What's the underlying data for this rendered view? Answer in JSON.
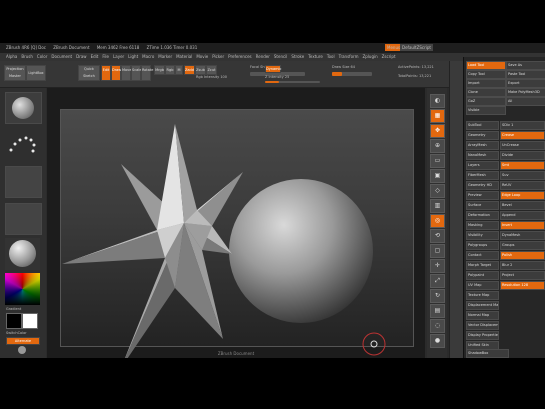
{
  "title_bar": {
    "items": [
      "ZBrush 4R6 [Q] Doc",
      "ZBrush Document",
      "Mem 3462 Free 6118",
      "ZTime 1.036 Timer 0.031"
    ],
    "right_buttons": [
      "Menus",
      "DefaultZScript"
    ]
  },
  "menu_bar": {
    "items": [
      "Alpha",
      "Brush",
      "Color",
      "Document",
      "Draw",
      "Edit",
      "File",
      "Layer",
      "Light",
      "Macro",
      "Marker",
      "Material",
      "Movie",
      "Picker",
      "Preferences",
      "Render",
      "Stencil",
      "Stroke",
      "Texture",
      "Tool",
      "Transform",
      "Zplugin",
      "Zscript"
    ]
  },
  "toolbar": {
    "projection_master": "Projection Master",
    "lightbox": "LightBox",
    "quick_sketch": "Quick Sketch",
    "edit": "Edit",
    "draw": "Draw",
    "move": "Move",
    "scale": "Scale",
    "rotate": "Rotate",
    "mrgb": "Mrgb",
    "rgb": "Rgb",
    "m": "M",
    "zadd": "Zadd",
    "zsub": "Zsub",
    "zcut": "Zcut",
    "focal_shift_label": "Focal Shift 0",
    "draw_size_label": "Draw Size 64",
    "dynamic": "Dynamic",
    "z_intensity_label": "Z Intensity 25",
    "rgb_intensity_label": "Rgb Intensity 100",
    "active_points": "ActivePoints: 13,221",
    "total_points": "TotalPoints: 13,221"
  },
  "left_shelf": {
    "brush_label": "Standard",
    "stroke_label": "Dots",
    "alpha_label": "Off",
    "texture_label": "Off",
    "material_label": "MatCap Gray",
    "gradient_label": "Gradient",
    "switch_color": "SwitchColor",
    "alternate": "Alternate"
  },
  "right_shelf": {
    "icons": [
      "BPR",
      "SPix 3",
      "Scroll",
      "Zoom",
      "Actual",
      "AAHalf",
      "Persp",
      "Floor",
      "Local",
      "LSym",
      "Frame",
      "Move",
      "Scale",
      "Rotate",
      "PolyF",
      "Transp",
      "Solo"
    ]
  },
  "tool_panel": {
    "header_buttons": [
      "Load Tool",
      "Save As",
      "Copy Tool",
      "Paste Tool",
      "Import",
      "Export",
      "Clone",
      "Make PolyMesh3D",
      "GoZ",
      "All",
      "Visible"
    ],
    "subtool_items": [
      "SubTool",
      "Geometry",
      "ArrayMesh",
      "NanoMesh",
      "Layers",
      "FiberMesh",
      "Geometry HD",
      "Preview",
      "Surface",
      "Deformation",
      "Masking",
      "Visibility",
      "Polygroups",
      "Contact",
      "Morph Target",
      "Polypaint",
      "UV Map",
      "Texture Map",
      "Displacement Map",
      "Normal Map",
      "Vector Displacement Map",
      "Display Properties",
      "Unified Skin",
      "Initialize",
      "Import",
      "Export"
    ],
    "slider_values": [
      "SDiv 1",
      "Crease",
      "UnCrease",
      "Divide",
      "Smt",
      "Suv",
      "ReUV",
      "Edge Loop",
      "Bevel",
      "Append",
      "Insert",
      "DynaMesh",
      "Groups",
      "Polish",
      "Blur 2",
      "Project",
      "Resolution 128"
    ],
    "active_item": "DynaMesh",
    "bottom_label": "ShadowBox"
  },
  "status_text": "ZBrush Document"
}
